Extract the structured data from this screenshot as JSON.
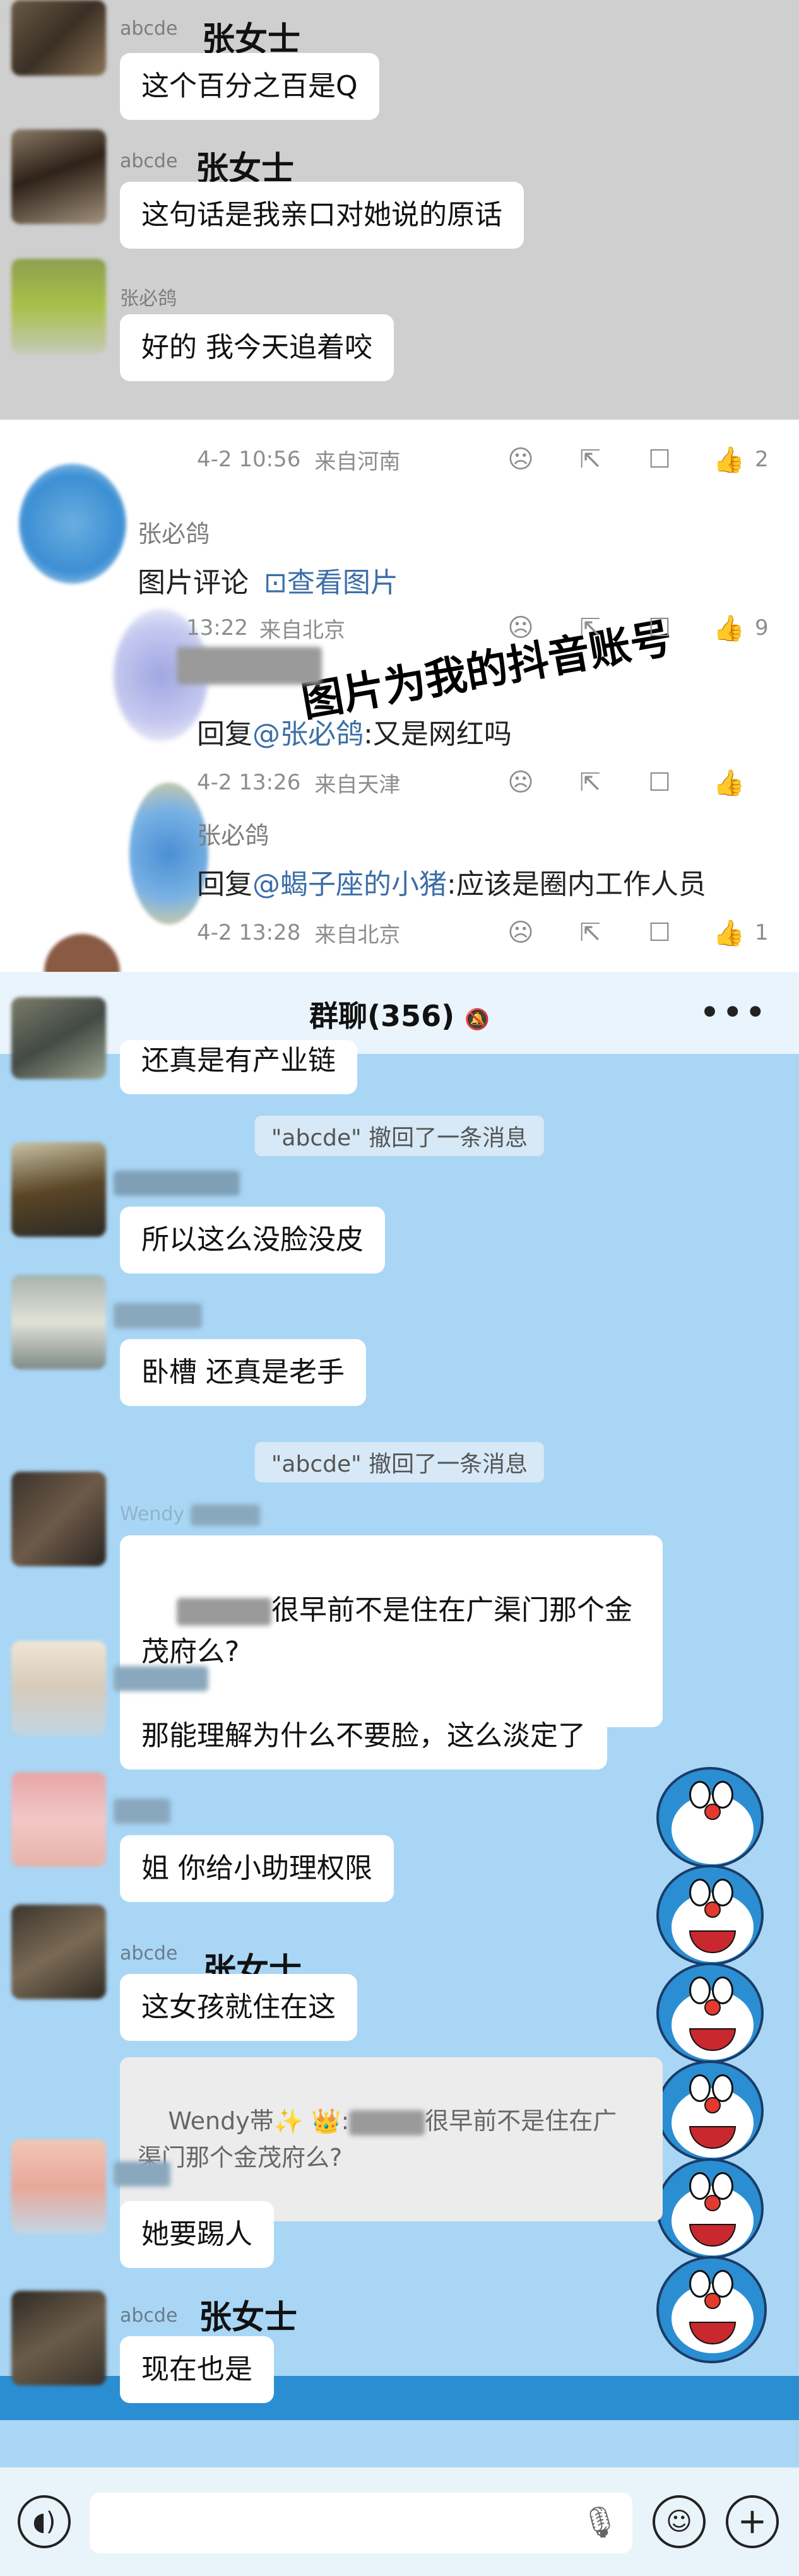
{
  "section1": {
    "messages": [
      {
        "sender": "abcde",
        "annotation": "张女士",
        "text": "这个百分之百是Q"
      },
      {
        "sender": "abcde",
        "annotation": "张女士",
        "text": "这句话是我亲口对她说的原话"
      },
      {
        "sender": "张必鸽",
        "annotation": "",
        "text": "好的 我今天追着咬"
      }
    ]
  },
  "section2": {
    "top_meta": {
      "time": "4-2 10:56",
      "location": "来自河南",
      "likes": "2"
    },
    "comment": {
      "name": "张必鸽",
      "text_prefix": "图片评论",
      "link": "查看图片"
    },
    "watermark": "图片为我的抖音账号",
    "reply1": {
      "meta_time": "13:22",
      "meta_location": "来自北京",
      "likes": "9",
      "reply_label": "回复",
      "mention": "@张必鸽",
      "text": ":又是网红吗",
      "time": "4-2 13:26",
      "location": "来自天津"
    },
    "reply2": {
      "name": "张必鸽",
      "reply_label": "回复",
      "mention": "@蝎子座的小猪",
      "text": ":应该是圈内工作人员",
      "time": "4-2 13:28",
      "location": "来自北京",
      "likes": "1"
    }
  },
  "section3": {
    "title": "群聊(356)",
    "messages": {
      "partial_top": "还真是有产业链",
      "recall1": "\"abcde\" 撤回了一条消息",
      "m1": "所以这么没脸没皮",
      "m2": "卧槽 还真是老手",
      "recall2": "\"abcde\" 撤回了一条消息",
      "m3_sender": "Wendy",
      "m3": "很早前不是住在广渠门那个金\n茂府么?",
      "m4": "那能理解为什么不要脸，这么淡定了",
      "m5": "姐 你给小助理权限",
      "m6_sender": "abcde",
      "m6_annotation": "张女士",
      "m6": "这女孩就住在这",
      "quote_prefix": "Wendy帯✨ 👑:",
      "quote_text": "很早前不是住在广\n渠门那个金茂府么?",
      "m7": "她要踢人",
      "m8_sender": "abcde",
      "m8_annotation": "张女士",
      "m8": "现在也是"
    },
    "input_placeholder": ""
  },
  "colors": {
    "chat_bg_gray": "#cfcfcf",
    "chat_bg_blue": "#a9d6f5",
    "link_blue": "#3d6fa8",
    "doraemon_blue": "#2b8ed3"
  },
  "icons": [
    "back-arrow-icon",
    "mute-bell-icon",
    "more-icon",
    "voice-icon",
    "mic-icon",
    "emoji-icon",
    "plus-icon",
    "dislike-icon",
    "share-icon",
    "comment-icon",
    "like-icon",
    "image-icon"
  ]
}
